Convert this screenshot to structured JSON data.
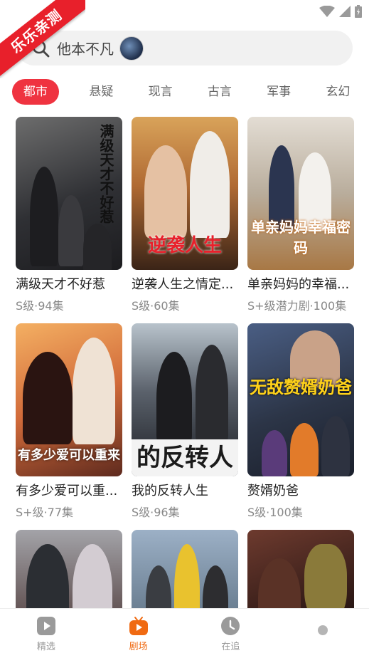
{
  "watermark": "乐乐亲测",
  "search": {
    "text": "他本不凡"
  },
  "tabs": [
    "都市",
    "悬疑",
    "现言",
    "古言",
    "军事",
    "玄幻"
  ],
  "cards": [
    {
      "title": "满级天才不好惹",
      "meta": "S级·94集",
      "art": "满级天才不好惹"
    },
    {
      "title": "逆袭人生之情定...",
      "meta": "S级·60集",
      "art": "逆袭人生"
    },
    {
      "title": "单亲妈妈的幸福...",
      "meta": "S+级潜力剧·100集",
      "art": "单亲妈妈幸福密码"
    },
    {
      "title": "有多少爱可以重...",
      "meta": "S+级·77集",
      "art": "有多少爱可以重来"
    },
    {
      "title": "我的反转人生",
      "meta": "S级·96集",
      "art": "的反转人"
    },
    {
      "title": "赘婿奶爸",
      "meta": "S级·100集",
      "art": "无敌赘婿奶爸"
    },
    {
      "title": "",
      "meta": "",
      "art": ""
    },
    {
      "title": "",
      "meta": "",
      "art": ""
    },
    {
      "title": "",
      "meta": "",
      "art": ""
    }
  ],
  "nav": [
    {
      "label": "精选",
      "icon": "play-icon",
      "active": false
    },
    {
      "label": "剧场",
      "icon": "tv-icon",
      "active": true
    },
    {
      "label": "在追",
      "icon": "clock-icon",
      "active": false
    },
    {
      "label": "",
      "icon": "profile-icon",
      "active": false
    }
  ],
  "colors": {
    "accent": "#ef3340",
    "nav_active": "#f06a12"
  }
}
